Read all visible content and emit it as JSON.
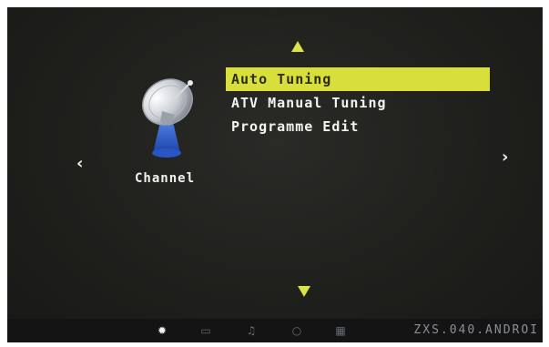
{
  "menu": {
    "title": "Channel",
    "items": [
      {
        "label": "Auto Tuning",
        "selected": true
      },
      {
        "label": "ATV Manual Tuning",
        "selected": false
      },
      {
        "label": "Programme Edit",
        "selected": false
      }
    ]
  },
  "nav": {
    "left_glyph": "‹",
    "right_glyph": "›",
    "up_icon": "up-triangle-icon",
    "down_icon": "down-triangle-icon"
  },
  "bottom_bar": {
    "icons": [
      {
        "name": "settings-gear-icon",
        "glyph": "✹",
        "active": true
      },
      {
        "name": "picture-icon",
        "glyph": "▭",
        "active": false
      },
      {
        "name": "sound-note-icon",
        "glyph": "♫",
        "active": false
      },
      {
        "name": "time-circle-icon",
        "glyph": "○",
        "active": false
      },
      {
        "name": "option-grid-icon",
        "glyph": "▦",
        "active": false
      }
    ],
    "code_text": "ZXS.040.ANDROI"
  },
  "colors": {
    "highlight": "#d8de3c",
    "arrow": "#d9e34a",
    "background": "#1f1f1c"
  }
}
